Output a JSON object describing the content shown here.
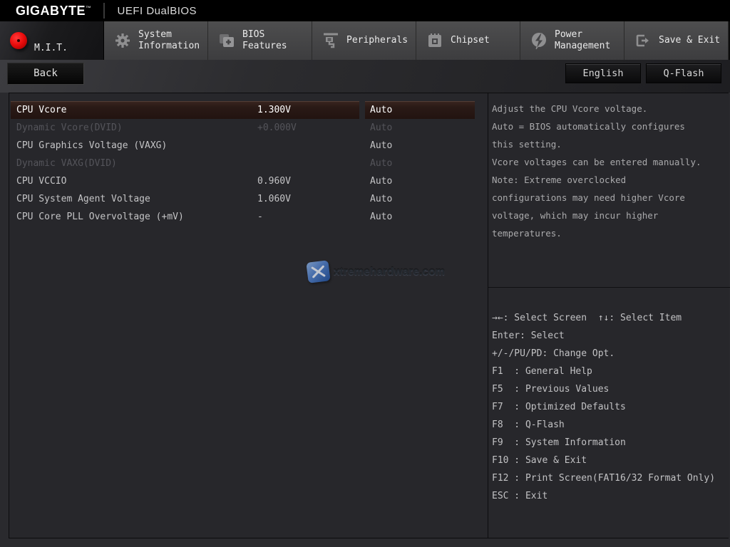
{
  "header": {
    "brand": "GIGABYTE",
    "trademark": "™",
    "title": "UEFI DualBIOS"
  },
  "tabs": [
    {
      "label": "M.I.T.",
      "icon": "red-disc-icon"
    },
    {
      "label": "System\nInformation",
      "icon": "gear-icon"
    },
    {
      "label": "BIOS\nFeatures",
      "icon": "folder-plus-icon"
    },
    {
      "label": "Peripherals",
      "icon": "peripheral-device-icon"
    },
    {
      "label": "Chipset",
      "icon": "chip-icon"
    },
    {
      "label": "Power\nManagement",
      "icon": "lightning-circle-icon"
    },
    {
      "label": "Save & Exit",
      "icon": "exit-arrow-icon"
    }
  ],
  "toolbar": {
    "back_label": "Back",
    "language_label": "English",
    "qflash_label": "Q-Flash"
  },
  "settings": {
    "rows": [
      {
        "label": "CPU Vcore",
        "value": "1.300V",
        "option": "Auto",
        "state": "selected"
      },
      {
        "label": "Dynamic Vcore(DVID)",
        "value": "+0.000V",
        "option": "Auto",
        "state": "disabled"
      },
      {
        "label": "CPU Graphics Voltage (VAXG)",
        "value": "",
        "option": "Auto",
        "state": "normal"
      },
      {
        "label": "Dynamic VAXG(DVID)",
        "value": "",
        "option": "Auto",
        "state": "disabled"
      },
      {
        "label": "CPU VCCIO",
        "value": "0.960V",
        "option": "Auto",
        "state": "normal"
      },
      {
        "label": "CPU System Agent Voltage",
        "value": "1.060V",
        "option": "Auto",
        "state": "normal"
      },
      {
        "label": "CPU Core PLL Overvoltage (+mV)",
        "value": "-",
        "option": "Auto",
        "state": "normal"
      }
    ]
  },
  "help_panel": {
    "lines": [
      "Adjust the CPU Vcore voltage.",
      "Auto = BIOS automatically configures",
      "this setting.",
      "Vcore voltages can be entered manually.",
      "Note: Extreme overclocked",
      "configurations may need higher Vcore",
      "voltage, which may incur higher",
      "temperatures."
    ]
  },
  "hints_panel": {
    "lines": [
      "→←: Select Screen  ↑↓: Select Item",
      "Enter: Select",
      "+/-/PU/PD: Change Opt.",
      "F1  : General Help",
      "F5  : Previous Values",
      "F7  : Optimized Defaults",
      "F8  : Q-Flash",
      "F9  : System Information",
      "F10 : Save & Exit",
      "F12 : Print Screen(FAT16/32 Format Only)",
      "ESC : Exit"
    ]
  },
  "watermark": {
    "text": "xtremehardware.com"
  },
  "colors": {
    "accent_red": "#ec0d0d",
    "highlight_row": "#2a1a16",
    "tab_gray": "#454547",
    "panel_bg": "#27272b",
    "watermark_blue": "#4f7fcb"
  }
}
